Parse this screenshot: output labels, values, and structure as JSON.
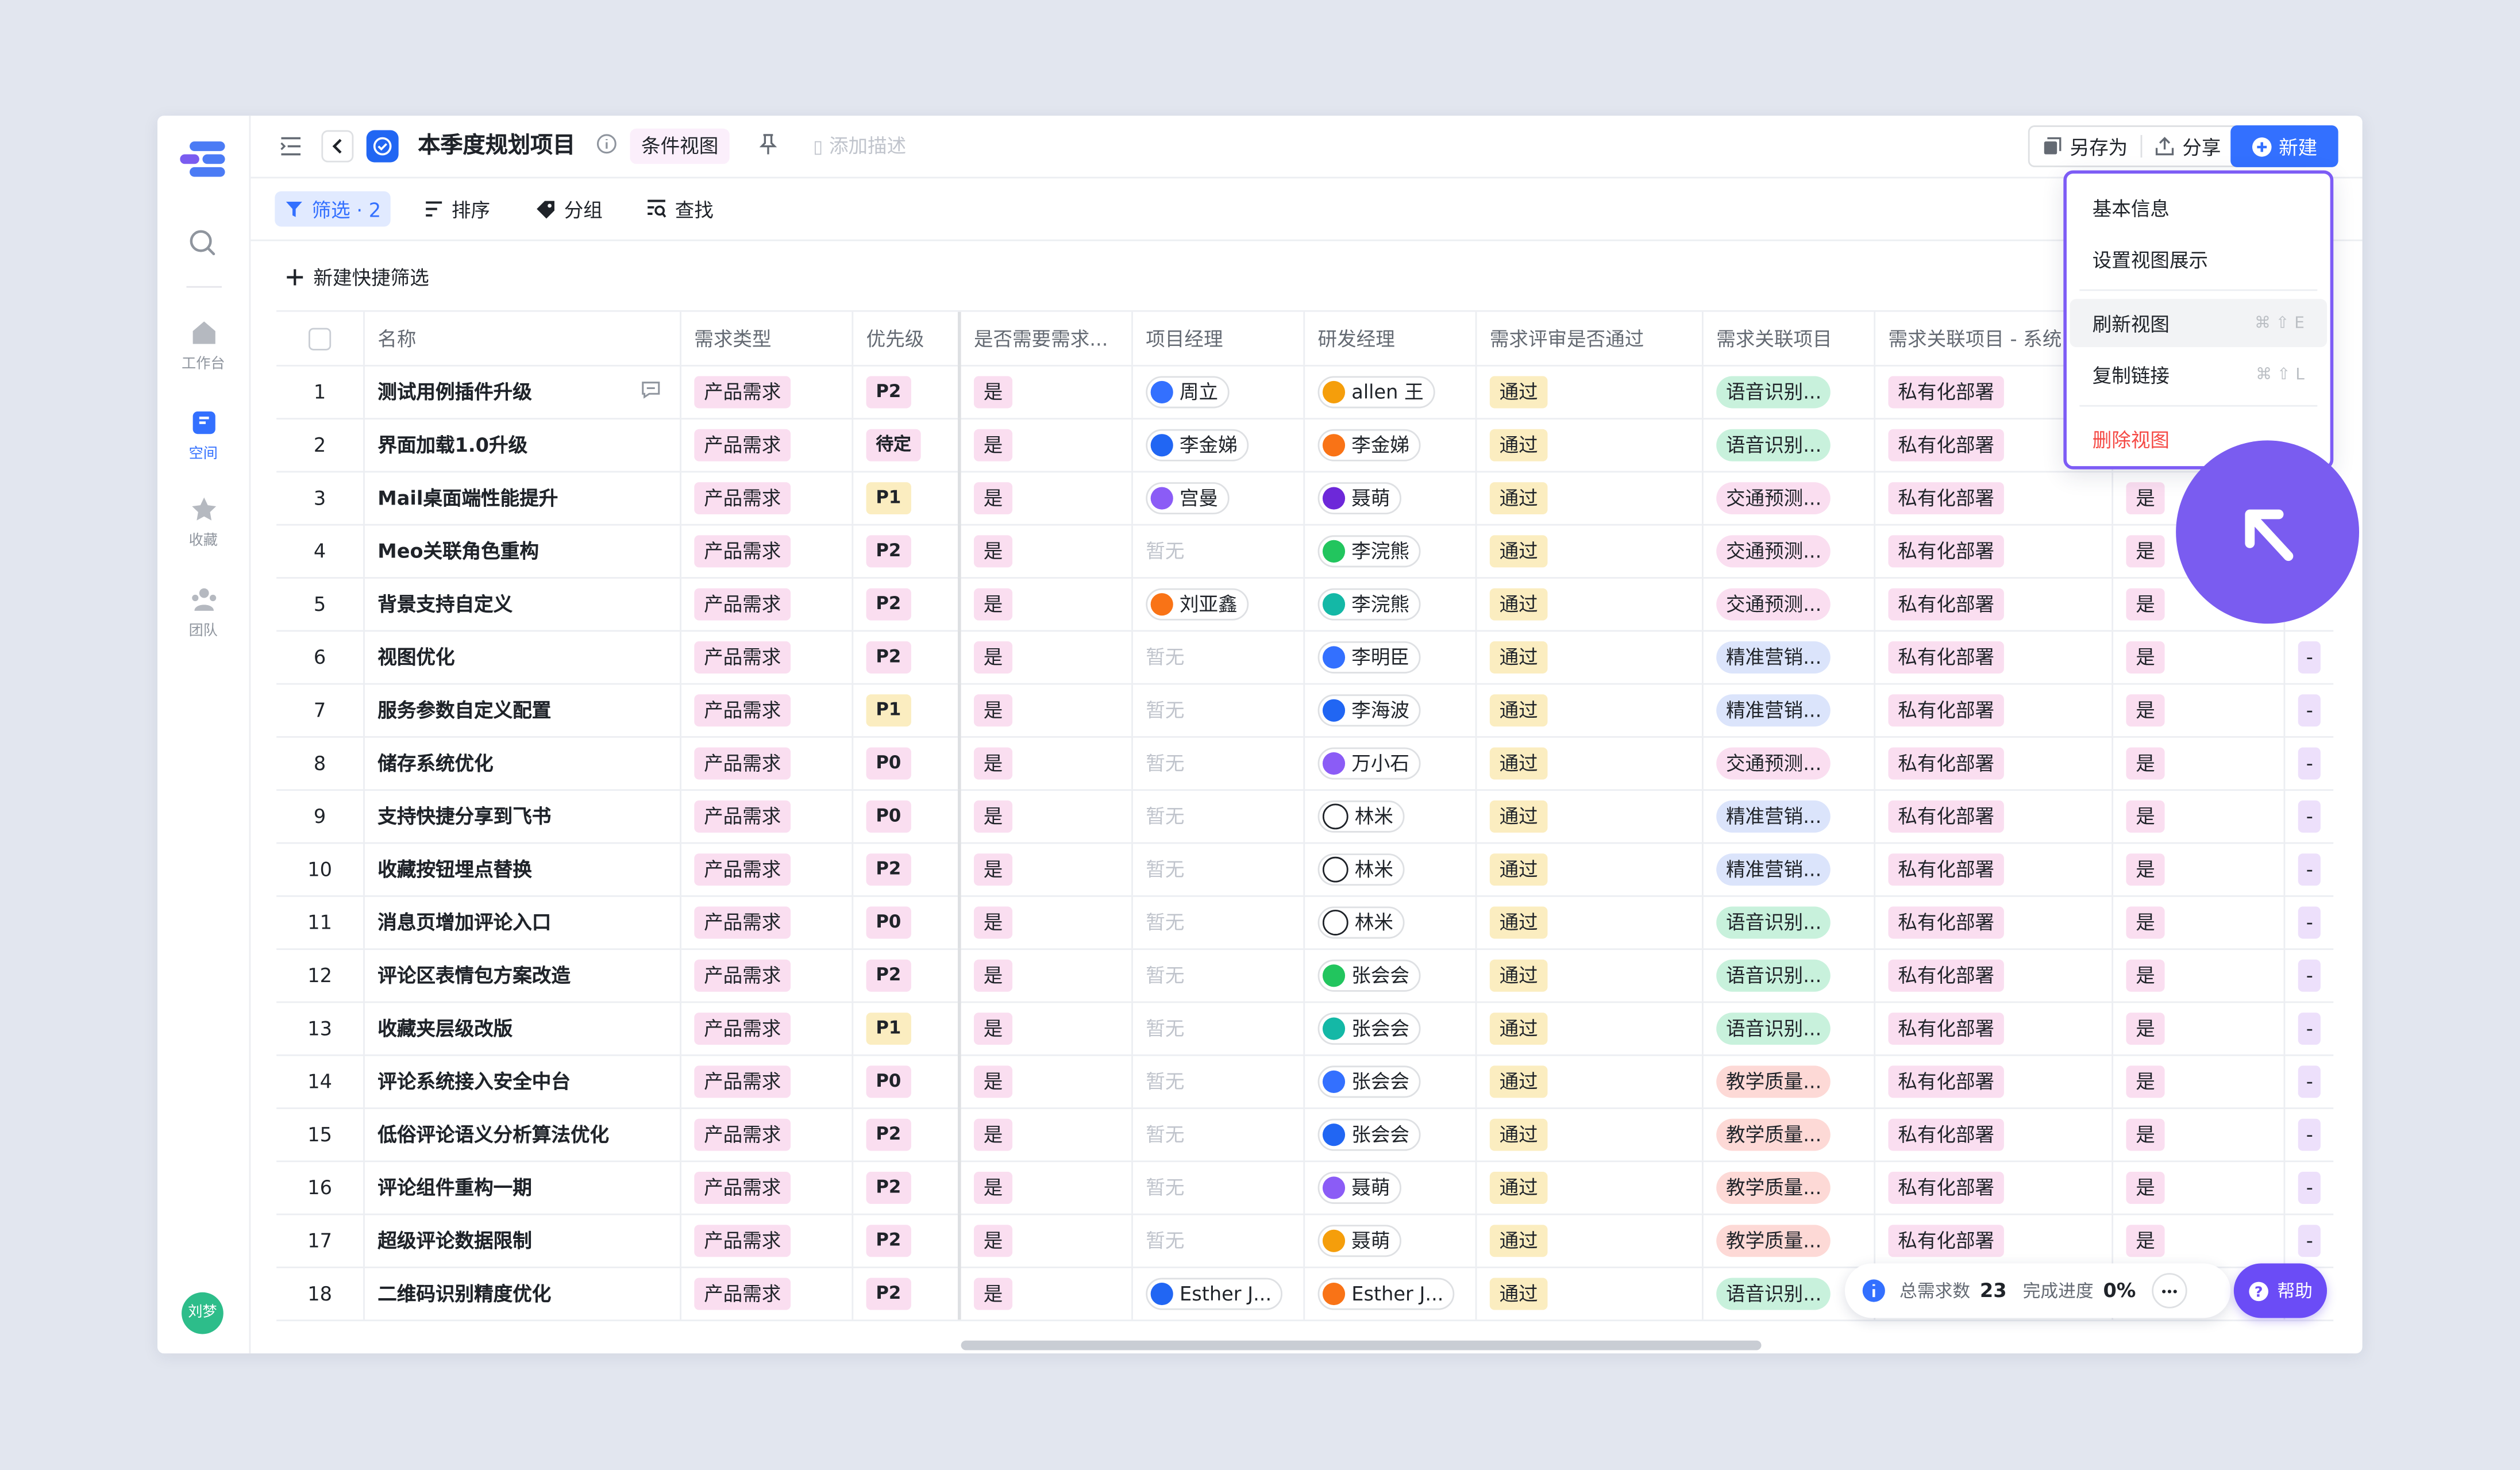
{
  "rail": {
    "items": [
      {
        "label": "工作台"
      },
      {
        "label": "空间"
      },
      {
        "label": "收藏"
      },
      {
        "label": "团队"
      }
    ],
    "user_avatar": "刘梦"
  },
  "header": {
    "title": "本季度规划项目",
    "view_tag": "条件视图",
    "add_desc": "添加描述",
    "save_as": "另存为",
    "share": "分享",
    "new_btn": "新建"
  },
  "toolbar": {
    "filter": "筛选 · 2",
    "sort": "排序",
    "group": "分组",
    "find": "查找",
    "quick_filter": "新建快捷筛选"
  },
  "table": {
    "headers": [
      "名称",
      "需求类型",
      "优先级",
      "是否需要需求...",
      "项目经理",
      "研发经理",
      "需求评审是否通过",
      "需求关联项目",
      "需求关联项目 - 系统"
    ],
    "rows": [
      {
        "n": "1",
        "name": "测试用例插件升级",
        "type": "产品需求",
        "pri": "P2",
        "need": "是",
        "pm": "周立",
        "pm_av": "周立",
        "dm": "allen 王",
        "dm_av": "王",
        "pass": "通过",
        "proj": "语音识别...",
        "pc": "green",
        "deploy": "私有化部署",
        "yes2": "",
        "dash": ""
      },
      {
        "n": "2",
        "name": "界面加载1.0升级",
        "type": "产品需求",
        "pri": "待定",
        "need": "是",
        "pm": "李金娣",
        "pm_av": "金娣",
        "dm": "李金娣",
        "dm_av": "金娣",
        "pass": "通过",
        "proj": "语音识别...",
        "pc": "green",
        "deploy": "私有化部署",
        "yes2": "",
        "dash": ""
      },
      {
        "n": "3",
        "name": "Mail桌面端性能提升",
        "type": "产品需求",
        "pri": "P1",
        "need": "是",
        "pm": "宫曼",
        "pm_av": "宫曼",
        "dm": "聂萌",
        "dm_av": "聂萌",
        "pass": "通过",
        "proj": "交通预测...",
        "pc": "pink",
        "deploy": "私有化部署",
        "yes2": "是",
        "dash": ""
      },
      {
        "n": "4",
        "name": "Meo关联角色重构",
        "type": "产品需求",
        "pri": "P2",
        "need": "是",
        "pm": "",
        "pm_av": "",
        "dm": "李浣熊",
        "dm_av": "浣熊",
        "pass": "通过",
        "proj": "交通预测...",
        "pc": "pink",
        "deploy": "私有化部署",
        "yes2": "是",
        "dash": ""
      },
      {
        "n": "5",
        "name": "背景支持自定义",
        "type": "产品需求",
        "pri": "P2",
        "need": "是",
        "pm": "刘亚鑫",
        "pm_av": "亚鑫",
        "dm": "李浣熊",
        "dm_av": "浣熊",
        "pass": "通过",
        "proj": "交通预测...",
        "pc": "pink",
        "deploy": "私有化部署",
        "yes2": "是",
        "dash": ""
      },
      {
        "n": "6",
        "name": "视图优化",
        "type": "产品需求",
        "pri": "P2",
        "need": "是",
        "pm": "",
        "pm_av": "",
        "dm": "李明臣",
        "dm_av": "明臣",
        "pass": "通过",
        "proj": "精准营销...",
        "pc": "blue",
        "deploy": "私有化部署",
        "yes2": "是",
        "dash": "-"
      },
      {
        "n": "7",
        "name": "服务参数自定义配置",
        "type": "产品需求",
        "pri": "P1",
        "need": "是",
        "pm": "",
        "pm_av": "",
        "dm": "李海波",
        "dm_av": "海波",
        "pass": "通过",
        "proj": "精准营销...",
        "pc": "blue",
        "deploy": "私有化部署",
        "yes2": "是",
        "dash": "-"
      },
      {
        "n": "8",
        "name": "储存系统优化",
        "type": "产品需求",
        "pri": "P0",
        "need": "是",
        "pm": "",
        "pm_av": "",
        "dm": "万小石",
        "dm_av": "小石",
        "pass": "通过",
        "proj": "交通预测...",
        "pc": "pink",
        "deploy": "私有化部署",
        "yes2": "是",
        "dash": "-"
      },
      {
        "n": "9",
        "name": "支持快捷分享到飞书",
        "type": "产品需求",
        "pri": "P0",
        "need": "是",
        "pm": "",
        "pm_av": "",
        "dm": "林米",
        "dm_av": "",
        "pass": "通过",
        "proj": "精准营销...",
        "pc": "blue",
        "deploy": "私有化部署",
        "yes2": "是",
        "dash": "-"
      },
      {
        "n": "10",
        "name": "收藏按钮埋点替换",
        "type": "产品需求",
        "pri": "P2",
        "need": "是",
        "pm": "",
        "pm_av": "",
        "dm": "林米",
        "dm_av": "",
        "pass": "通过",
        "proj": "精准营销...",
        "pc": "blue",
        "deploy": "私有化部署",
        "yes2": "是",
        "dash": "-"
      },
      {
        "n": "11",
        "name": "消息页增加评论入口",
        "type": "产品需求",
        "pri": "P0",
        "need": "是",
        "pm": "",
        "pm_av": "",
        "dm": "林米",
        "dm_av": "",
        "pass": "通过",
        "proj": "语音识别...",
        "pc": "green",
        "deploy": "私有化部署",
        "yes2": "是",
        "dash": "-"
      },
      {
        "n": "12",
        "name": "评论区表情包方案改造",
        "type": "产品需求",
        "pri": "P2",
        "need": "是",
        "pm": "",
        "pm_av": "",
        "dm": "张会会",
        "dm_av": "会会",
        "pass": "通过",
        "proj": "语音识别...",
        "pc": "green",
        "deploy": "私有化部署",
        "yes2": "是",
        "dash": "-"
      },
      {
        "n": "13",
        "name": "收藏夹层级改版",
        "type": "产品需求",
        "pri": "P1",
        "need": "是",
        "pm": "",
        "pm_av": "",
        "dm": "张会会",
        "dm_av": "会会",
        "pass": "通过",
        "proj": "语音识别...",
        "pc": "green",
        "deploy": "私有化部署",
        "yes2": "是",
        "dash": "-"
      },
      {
        "n": "14",
        "name": "评论系统接入安全中台",
        "type": "产品需求",
        "pri": "P0",
        "need": "是",
        "pm": "",
        "pm_av": "",
        "dm": "张会会",
        "dm_av": "会会",
        "pass": "通过",
        "proj": "教学质量...",
        "pc": "red",
        "deploy": "私有化部署",
        "yes2": "是",
        "dash": "-"
      },
      {
        "n": "15",
        "name": "低俗评论语义分析算法优化",
        "type": "产品需求",
        "pri": "P2",
        "need": "是",
        "pm": "",
        "pm_av": "",
        "dm": "张会会",
        "dm_av": "会会",
        "pass": "通过",
        "proj": "教学质量...",
        "pc": "red",
        "deploy": "私有化部署",
        "yes2": "是",
        "dash": "-"
      },
      {
        "n": "16",
        "name": "评论组件重构一期",
        "type": "产品需求",
        "pri": "P2",
        "need": "是",
        "pm": "",
        "pm_av": "",
        "dm": "聂萌",
        "dm_av": "聂萌",
        "pass": "通过",
        "proj": "教学质量...",
        "pc": "red",
        "deploy": "私有化部署",
        "yes2": "是",
        "dash": "-"
      },
      {
        "n": "17",
        "name": "超级评论数据限制",
        "type": "产品需求",
        "pri": "P2",
        "need": "是",
        "pm": "",
        "pm_av": "",
        "dm": "聂萌",
        "dm_av": "聂萌",
        "pass": "通过",
        "proj": "教学质量...",
        "pc": "red",
        "deploy": "私有化部署",
        "yes2": "是",
        "dash": "-"
      },
      {
        "n": "18",
        "name": "二维码识别精度优化",
        "type": "产品需求",
        "pri": "P2",
        "need": "是",
        "pm": "Esther J...",
        "pm_av": "EJ",
        "dm": "Esther J...",
        "dm_av": "EJ",
        "pass": "通过",
        "proj": "语音识别...",
        "pc": "green",
        "deploy": "私有化部署",
        "yes2": "",
        "dash": ""
      }
    ],
    "empty_label": "暂无"
  },
  "menu": {
    "items": [
      "基本信息",
      "设置视图展示",
      "刷新视图",
      "复制链接",
      "删除视图"
    ],
    "shortcut_refresh": "⌘ ⇧ E",
    "shortcut_copy": "⌘ ⇧ L"
  },
  "status": {
    "total_label": "总需求数",
    "total_value": "23",
    "progress_label": "完成进度",
    "progress_value": "0%"
  },
  "help": "帮助",
  "colors": {
    "accent": "#3370ff",
    "menu_border": "#7d5cf5",
    "danger": "#f54a45"
  }
}
